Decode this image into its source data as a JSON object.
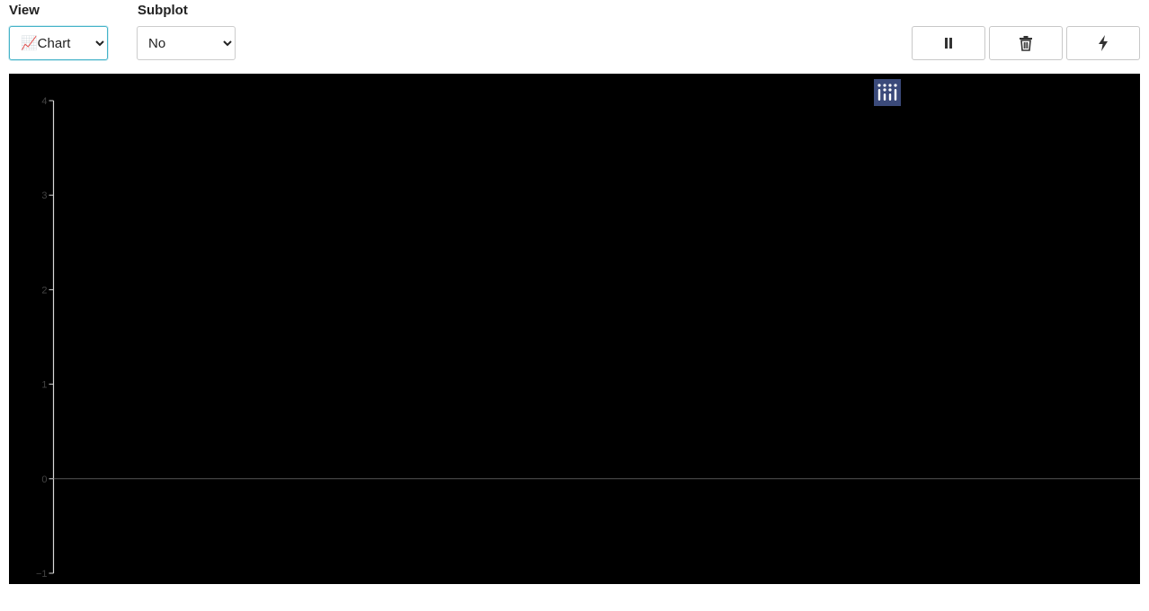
{
  "view": {
    "label": "View",
    "selected": "📈Chart"
  },
  "subplot": {
    "label": "Subplot",
    "selected": "No"
  },
  "toolbar": {
    "buttons": [
      {
        "name": "pause-button",
        "icon": "pause-icon"
      },
      {
        "name": "delete-button",
        "icon": "trash-icon"
      },
      {
        "name": "lightning-button",
        "icon": "lightning-icon"
      }
    ]
  },
  "modebar": {
    "icons": [
      "camera-icon",
      "zoom-icon",
      "pan-icon",
      "zoom-in-icon",
      "zoom-out-icon",
      "autoscale-icon",
      "home-icon",
      "plotly-logo-icon"
    ]
  },
  "chart_data": {
    "type": "line",
    "title": "",
    "xlabel": "",
    "ylabel": "",
    "series": [],
    "ylim": [
      -1,
      4
    ],
    "yticks": [
      "−1",
      "0",
      "1",
      "2",
      "3",
      "4"
    ],
    "background": "#000000",
    "zeroline": true
  },
  "colors": {
    "focus": "#45b3c9",
    "plot_bg": "#000000",
    "modebar_active": "#3b4a7a"
  }
}
